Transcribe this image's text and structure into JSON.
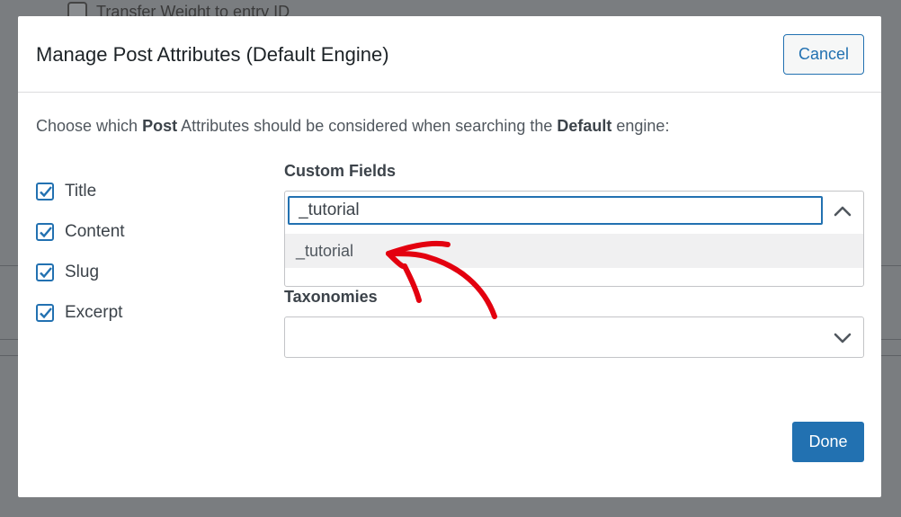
{
  "background": {
    "row_label": "Transfer Weight to entry ID"
  },
  "modal": {
    "title": "Manage Post Attributes (Default Engine)",
    "cancel_label": "Cancel",
    "intro": {
      "part1": "Choose which ",
      "bold1": "Post",
      "part2": " Attributes should be considered when searching the ",
      "bold2": "Default",
      "part3": " engine:"
    },
    "attributes": [
      {
        "label": "Title",
        "checked": true
      },
      {
        "label": "Content",
        "checked": true
      },
      {
        "label": "Slug",
        "checked": true
      },
      {
        "label": "Excerpt",
        "checked": true
      }
    ],
    "custom_fields": {
      "label": "Custom Fields",
      "input_value": "_tutorial",
      "options": [
        "_tutorial"
      ]
    },
    "taxonomies": {
      "label": "Taxonomies",
      "value": ""
    },
    "done_label": "Done"
  },
  "colors": {
    "accent": "#2271b1",
    "annotation_arrow": "#e3000f",
    "overlay": "#646970"
  }
}
